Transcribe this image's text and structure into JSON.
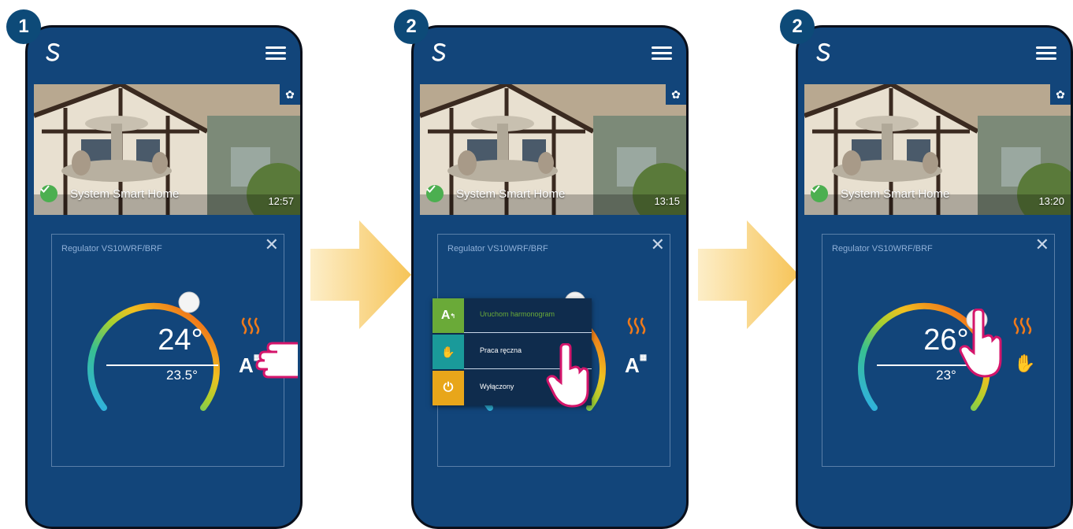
{
  "steps": [
    {
      "badge": "1",
      "home_name": "System Smart Home",
      "time": "12:57",
      "device": "Regulator VS10WRF/BRF",
      "set_temp": "24°",
      "current_temp": "23.5°"
    },
    {
      "badge": "2",
      "home_name": "System Smart Home",
      "time": "13:15",
      "device": "Regulator VS10WRF/BRF",
      "modes": [
        {
          "label": "Uruchom harmonogram",
          "color": "#6aaa38",
          "icon": "schedule-auto-icon"
        },
        {
          "label": "Praca ręczna",
          "color": "#1a9a9a",
          "icon": "hand-icon"
        },
        {
          "label": "Wyłączony",
          "color": "#e8a61a",
          "icon": "power-icon"
        }
      ]
    },
    {
      "badge": "2",
      "home_name": "System Smart Home",
      "time": "13:20",
      "device": "Regulator VS10WRF/BRF",
      "set_temp": "26°",
      "current_temp": "23°"
    }
  ],
  "colors": {
    "phone_bg": "#12457a",
    "badge_bg": "#0d4a78",
    "arrow": "#f6c458",
    "heat": "#f07a1a",
    "pointer": "#d4156b"
  }
}
